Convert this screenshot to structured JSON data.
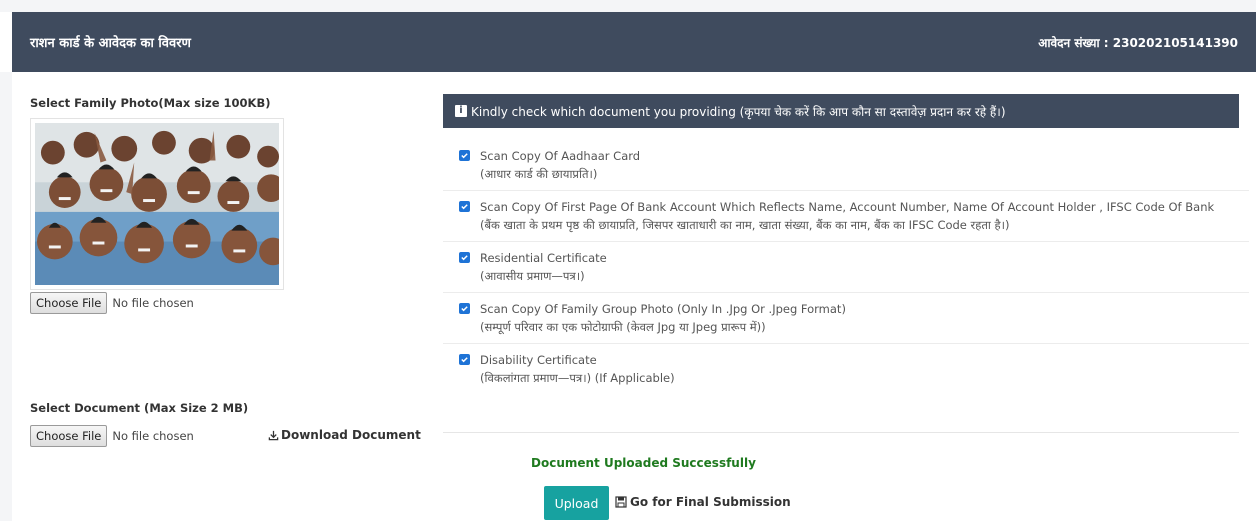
{
  "header": {
    "title": "राशन कार्ड के आवेदक का विवरण",
    "application_number": "आवेदन संख्या : 230202105141390"
  },
  "photo_section": {
    "label": "Select Family Photo(Max size 100KB)",
    "choose_label": "Choose File",
    "no_file": "No file chosen"
  },
  "document_section": {
    "label": "Select Document (Max Size 2 MB)",
    "choose_label": "Choose File",
    "no_file": "No file chosen",
    "download_label": "Download Document"
  },
  "panel": {
    "heading": "Kindly check which document you providing (कृपया चेक करें कि आप कौन सा दस्तावेज़ प्रदान कर रहे हैं।)",
    "items": [
      {
        "label": "Scan Copy Of Aadhaar Card",
        "sub": "(आधार कार्ड की छायाप्रति।)",
        "checked": true
      },
      {
        "label": "Scan Copy Of First Page Of Bank Account Which Reflects Name, Account Number, Name Of Account Holder , IFSC Code Of Bank",
        "sub": "(बैंक खाता के प्रथम पृष्ठ की छायाप्रति, जिसपर खाताधारी का नाम, खाता संख्या, बैंक का नाम, बैंक का IFSC Code रहता है।)",
        "checked": true
      },
      {
        "label": "Residential Certificate",
        "sub": "(आवासीय प्रमाण—पत्र।)",
        "checked": true
      },
      {
        "label": "Scan Copy Of Family Group Photo (Only In .Jpg Or .Jpeg Format)",
        "sub": "(सम्पूर्ण परिवार का एक फोटोग्राफी (केवल Jpg या Jpeg प्रारूप में))",
        "checked": true
      },
      {
        "label": "Disability Certificate",
        "sub": "(विकलांगता प्रमाण—पत्र।) (If Applicable)",
        "checked": true
      }
    ]
  },
  "status": {
    "message": "Document Uploaded Successfully"
  },
  "actions": {
    "upload_label": "Upload",
    "final_label": "Go for Final Submission"
  },
  "colors": {
    "header_bg": "#3f4b5e",
    "checkbox": "#1e73d6",
    "success": "#1f7a1f",
    "upload_bg": "#17a2a0"
  }
}
